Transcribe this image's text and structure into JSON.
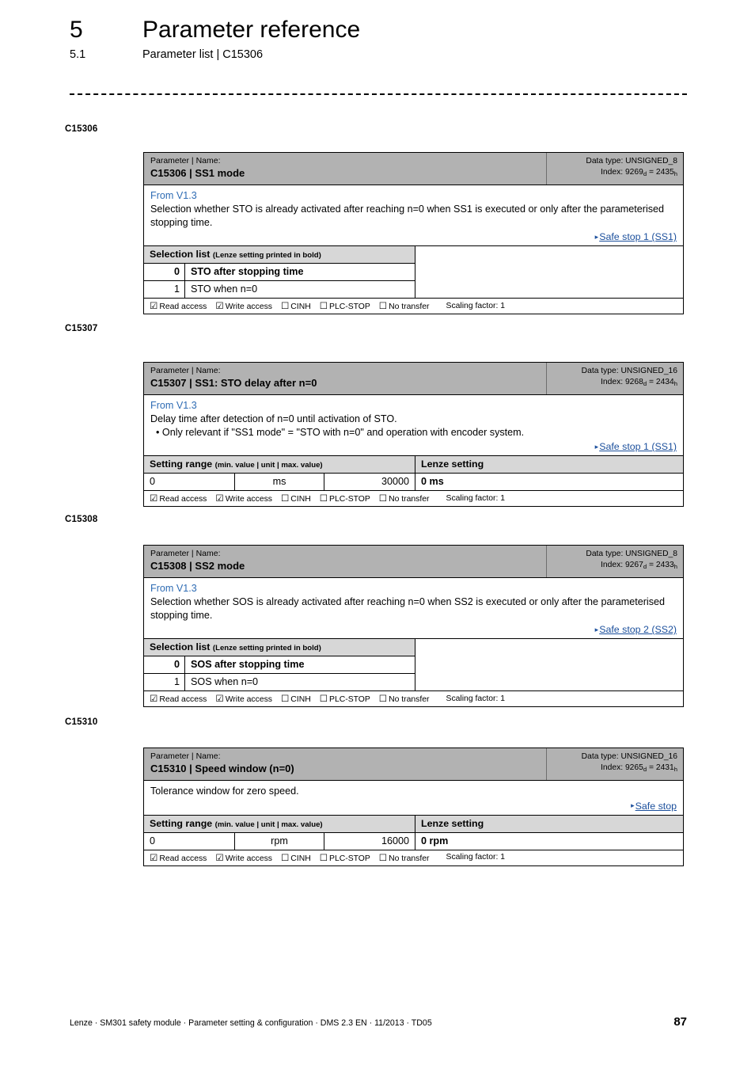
{
  "header": {
    "chapter_number": "5",
    "chapter_title": "Parameter reference",
    "section_number": "5.1",
    "section_title": "Parameter list | C15306"
  },
  "access_labels": {
    "read": "Read access",
    "write": "Write access",
    "cinh": "CINH",
    "plc_stop": "PLC-STOP",
    "no_transfer": "No transfer",
    "checked_box": "☑",
    "unchecked_box": "☐",
    "scaling": "Scaling factor: 1"
  },
  "common": {
    "param_name_label": "Parameter | Name:",
    "selection_list_title": "Selection list",
    "selection_list_sub": "(Lenze setting printed in bold)",
    "setting_range_title": "Setting range",
    "setting_range_sub": "(min. value | unit | max. value)",
    "lenze_setting_title": "Lenze setting",
    "xref_arrow": "▸"
  },
  "blocks": [
    {
      "margin_label": "C15306",
      "name": "C15306 | SS1 mode",
      "data_type": "Data type: UNSIGNED_8",
      "index_prefix": "Index: 9269",
      "index_sub_d": "d",
      "index_mid": " = 2435",
      "index_sub_h": "h",
      "from_version": "From V1.3",
      "description": "Selection whether STO is already activated after reaching n=0 when SS1 is executed or only after the parameterised stopping time.",
      "bullet": "",
      "xref": "Safe stop 1 (SS1)",
      "table_type": "selection",
      "options": [
        {
          "code": "0",
          "text": "STO after stopping time",
          "bold": true
        },
        {
          "code": "1",
          "text": "STO when n=0",
          "bold": false
        }
      ]
    },
    {
      "margin_label": "C15307",
      "name": "C15307 | SS1: STO delay after n=0",
      "data_type": "Data type: UNSIGNED_16",
      "index_prefix": "Index: 9268",
      "index_sub_d": "d",
      "index_mid": " = 2434",
      "index_sub_h": "h",
      "from_version": "From V1.3",
      "description": "Delay time after detection of n=0 until activation of STO.",
      "bullet": "• Only relevant if \"SS1 mode\" = \"STO with n=0\" and operation with encoder system.",
      "xref": "Safe stop 1 (SS1)",
      "table_type": "range",
      "min_value": "0",
      "unit": "ms",
      "max_value": "30000",
      "lenze_setting": "0 ms"
    },
    {
      "margin_label": "C15308",
      "name": "C15308 | SS2 mode",
      "data_type": "Data type: UNSIGNED_8",
      "index_prefix": "Index: 9267",
      "index_sub_d": "d",
      "index_mid": " = 2433",
      "index_sub_h": "h",
      "from_version": "From V1.3",
      "description": "Selection whether SOS is already activated after reaching n=0 when SS2 is executed or only after the parameterised stopping time.",
      "bullet": "",
      "xref": "Safe stop 2 (SS2)",
      "table_type": "selection",
      "options": [
        {
          "code": "0",
          "text": "SOS after stopping time",
          "bold": true
        },
        {
          "code": "1",
          "text": "SOS when n=0",
          "bold": false
        }
      ]
    },
    {
      "margin_label": "C15310",
      "name": "C15310 | Speed window (n=0)",
      "data_type": "Data type: UNSIGNED_16",
      "index_prefix": "Index: 9265",
      "index_sub_d": "d",
      "index_mid": " = 2431",
      "index_sub_h": "h",
      "from_version": "",
      "description": "Tolerance window for zero speed.",
      "bullet": "",
      "xref": "Safe stop",
      "table_type": "range",
      "min_value": "0",
      "unit": "rpm",
      "max_value": "16000",
      "lenze_setting": "0 rpm"
    }
  ],
  "footer": {
    "text": "Lenze · SM301 safety module · Parameter setting & configuration · DMS 2.3 EN · 11/2013 · TD05",
    "page_number": "87"
  },
  "colors": {
    "header_gray": "#b2b2b2",
    "subheader_gray": "#d7d7d7",
    "link_blue": "#1b4f9c",
    "version_blue": "#2f6cb4"
  }
}
